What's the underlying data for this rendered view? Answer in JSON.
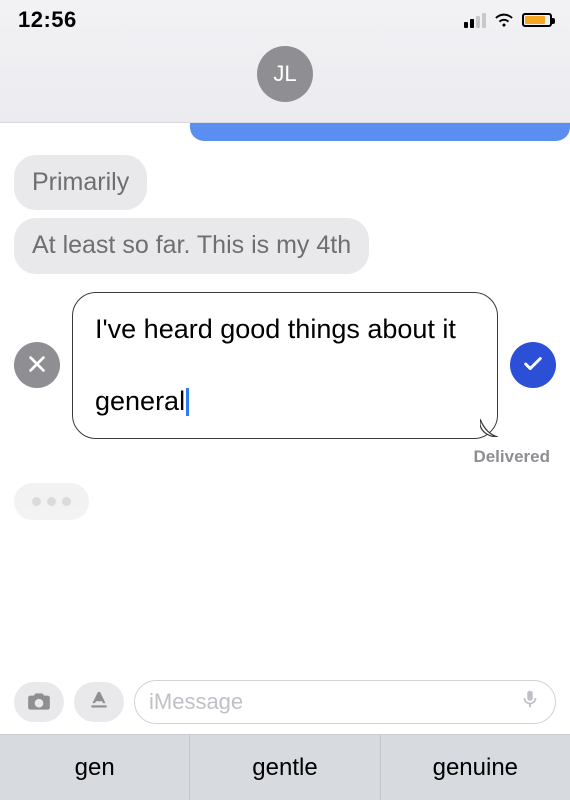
{
  "status": {
    "time": "12:56"
  },
  "contact": {
    "initials": "JL"
  },
  "messages": {
    "recv1": "Primarily",
    "recv2": "At least so far. This is my 4th"
  },
  "editing": {
    "line1": "I've heard good things about it",
    "line2_partial": "general"
  },
  "delivered_label": "Delivered",
  "input": {
    "placeholder": "iMessage"
  },
  "suggestions": {
    "s1": "gen",
    "s2": "gentle",
    "s3": "genuine"
  }
}
